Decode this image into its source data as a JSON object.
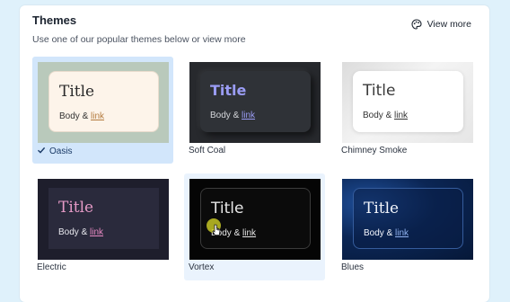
{
  "header": {
    "title": "Themes",
    "subtitle": "Use one of our popular themes below or view more",
    "view_more_label": "View more",
    "view_more_icon": "palette-icon"
  },
  "themes": [
    {
      "name": "Oasis",
      "selected": true,
      "preview_title": "Title",
      "preview_body": "Body & ",
      "preview_link": "link"
    },
    {
      "name": "Soft Coal",
      "selected": false,
      "preview_title": "Title",
      "preview_body": "Body & ",
      "preview_link": "link"
    },
    {
      "name": "Chimney Smoke",
      "selected": false,
      "preview_title": "Title",
      "preview_body": "Body & ",
      "preview_link": "link"
    },
    {
      "name": "Electric",
      "selected": false,
      "preview_title": "Title",
      "preview_body": "Body & ",
      "preview_link": "link"
    },
    {
      "name": "Vortex",
      "selected": false,
      "hovered": true,
      "preview_title": "Title",
      "preview_body": "Body & ",
      "preview_link": "link"
    },
    {
      "name": "Blues",
      "selected": false,
      "preview_title": "Title",
      "preview_body": "Body & ",
      "preview_link": "link"
    }
  ],
  "colors": {
    "selected_bg": "#d2e6fb",
    "hover_bg": "#eaf3fd",
    "page_bg": "#dff1fb"
  }
}
